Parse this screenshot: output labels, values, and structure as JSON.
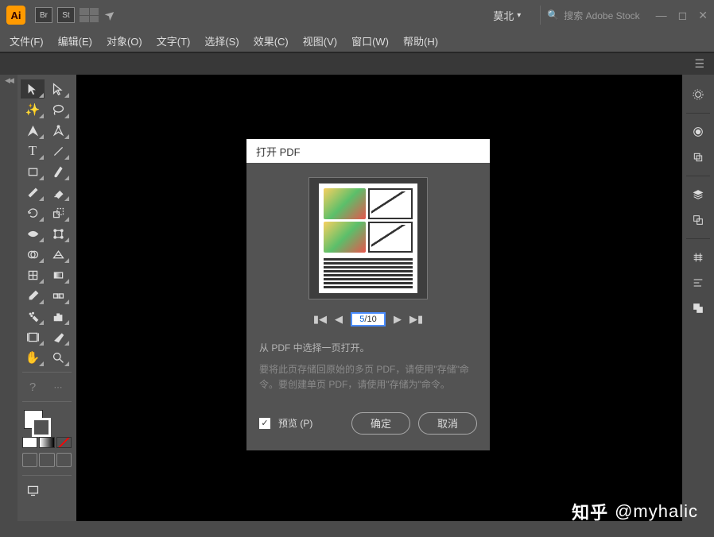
{
  "titlebar": {
    "logo": "Ai",
    "icons": {
      "br": "Br",
      "st": "St"
    },
    "dropdown": "莫北",
    "search_placeholder": "搜索 Adobe Stock"
  },
  "menu": {
    "file": "文件(F)",
    "edit": "编辑(E)",
    "object": "对象(O)",
    "type": "文字(T)",
    "select": "选择(S)",
    "effect": "效果(C)",
    "view": "视图(V)",
    "window": "窗口(W)",
    "help": "帮助(H)"
  },
  "dialog": {
    "title": "打开 PDF",
    "page_current": "5",
    "page_total": "/10",
    "instruction": "从 PDF 中选择一页打开。",
    "hint": "要将此页存储回原始的多页 PDF，请使用\"存储\"命令。要创建单页 PDF，请使用\"存储为\"命令。",
    "preview_label": "预览 (P)",
    "ok": "确定",
    "cancel": "取消"
  },
  "watermark": {
    "logo": "知乎",
    "user": "@myhalic"
  }
}
